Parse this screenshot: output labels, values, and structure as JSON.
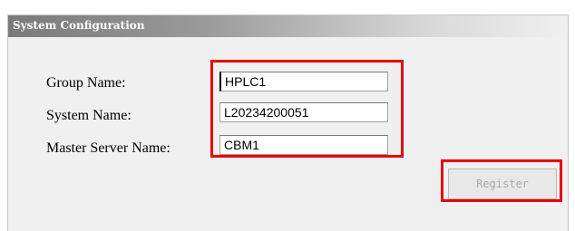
{
  "panel": {
    "title": "System Configuration"
  },
  "form": {
    "group_name": {
      "label": "Group Name:",
      "value": "HPLC1"
    },
    "system_name": {
      "label": "System Name:",
      "value": "L20234200051"
    },
    "master_server_name": {
      "label": "Master Server Name:",
      "value": "CBM1"
    }
  },
  "actions": {
    "register_label": "Register",
    "register_enabled": false
  },
  "colors": {
    "highlight": "#e8000b",
    "panel_background": "#f0f0f0",
    "header_gradient_start": "#7a7a7a",
    "disabled_text": "#a9a9a9"
  }
}
